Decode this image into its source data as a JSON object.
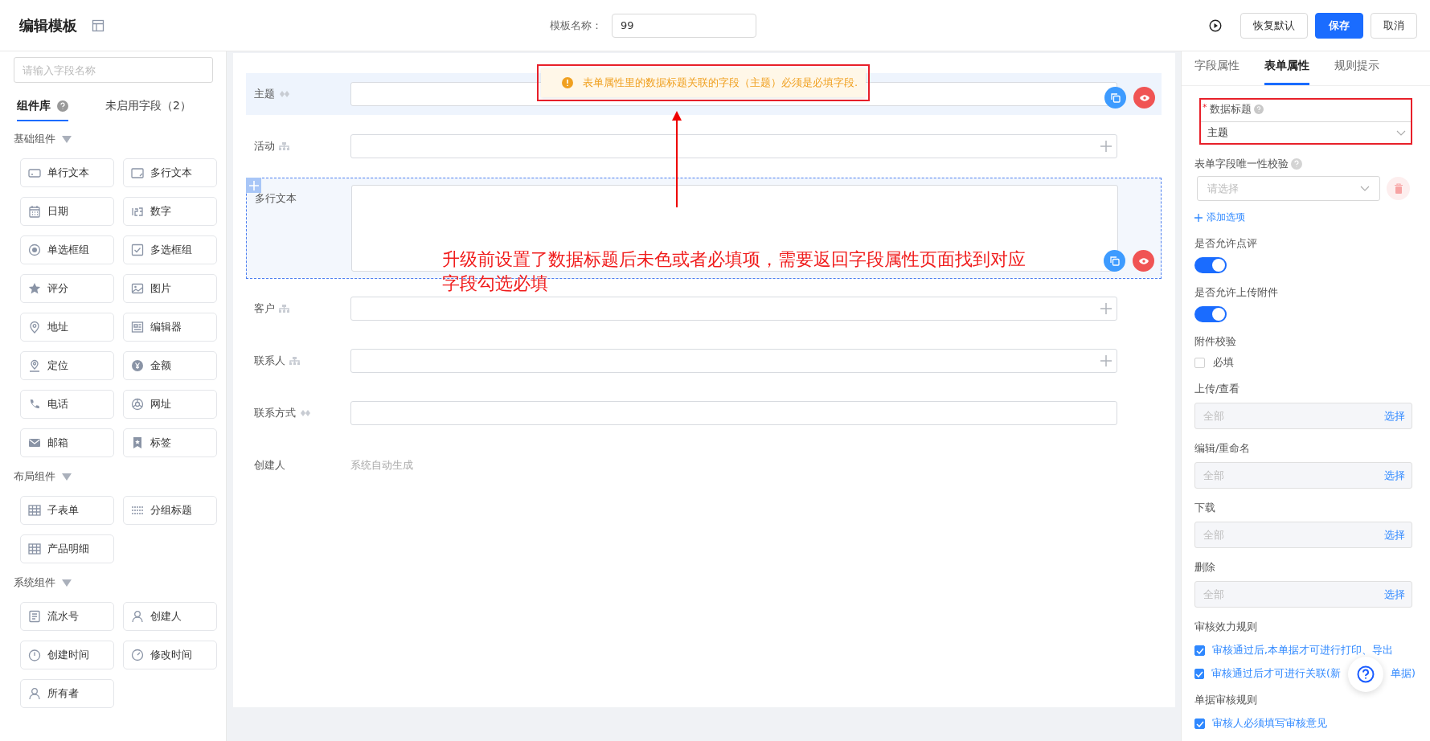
{
  "header": {
    "title": "编辑模板",
    "name_label": "模板名称：",
    "name_value": "99",
    "buttons": [
      {
        "label": "恢复默认",
        "kind": "default"
      },
      {
        "label": "保存",
        "kind": "primary"
      },
      {
        "label": "取消",
        "kind": "default"
      }
    ]
  },
  "sidebar": {
    "search_placeholder": "请输入字段名称",
    "tabs": [
      {
        "label": "组件库",
        "selected": true,
        "help": true
      },
      {
        "label": "未启用字段（2）",
        "selected": false,
        "help": false
      }
    ],
    "groups": [
      {
        "title": "基础组件",
        "items": [
          {
            "label": "单行文本"
          },
          {
            "label": "多行文本"
          },
          {
            "label": "日期"
          },
          {
            "label": "数字"
          },
          {
            "label": "单选框组"
          },
          {
            "label": "多选框组"
          },
          {
            "label": "评分"
          },
          {
            "label": "图片"
          },
          {
            "label": "地址"
          },
          {
            "label": "编辑器"
          },
          {
            "label": "定位"
          },
          {
            "label": "金额"
          },
          {
            "label": "电话"
          },
          {
            "label": "网址"
          },
          {
            "label": "邮箱"
          },
          {
            "label": "标签"
          }
        ]
      },
      {
        "title": "布局组件",
        "items": [
          {
            "label": "子表单"
          },
          {
            "label": "分组标题"
          },
          {
            "label": "产品明细"
          }
        ]
      },
      {
        "title": "系统组件",
        "items": [
          {
            "label": "流水号"
          },
          {
            "label": "创建人"
          },
          {
            "label": "创建时间"
          },
          {
            "label": "修改时间"
          },
          {
            "label": "所有者"
          }
        ]
      }
    ]
  },
  "form": {
    "toast": "表单属性里的数据标题关联的字段（主题）必须是必填字段.",
    "fields": [
      {
        "label": "主题",
        "kind": "text",
        "hovered": true,
        "selected": false
      },
      {
        "label": "活动",
        "kind": "relation",
        "hovered": false,
        "selected": false
      },
      {
        "label": "多行文本",
        "kind": "multiline",
        "hovered": false,
        "selected": true
      },
      {
        "label": "客户",
        "kind": "relation",
        "hovered": false,
        "selected": false
      },
      {
        "label": "联系人",
        "kind": "relation",
        "hovered": false,
        "selected": false
      },
      {
        "label": "联系方式",
        "kind": "text",
        "hovered": false,
        "selected": false
      },
      {
        "label": "创建人",
        "kind": "auto",
        "value": "系统自动生成",
        "hovered": false,
        "selected": false
      }
    ]
  },
  "annotation": {
    "text": "升级前设置了数据标题后未色或者必填项，需要返回字段属性页面找到对应字段勾选必填"
  },
  "properties": {
    "tabs": [
      {
        "label": "字段属性",
        "selected": false
      },
      {
        "label": "表单属性",
        "selected": true
      },
      {
        "label": "规则提示",
        "selected": false
      }
    ],
    "data_title": {
      "required_mark": "*",
      "label": "数据标题",
      "value": "主题"
    },
    "unique": {
      "label": "表单字段唯一性校验",
      "placeholder": "请选择",
      "add_label": "添加选项"
    },
    "toggles": [
      {
        "label": "是否允许点评",
        "on": true
      },
      {
        "label": "是否允许上传附件",
        "on": true
      }
    ],
    "attachment": {
      "label": "附件校验",
      "option": "必填",
      "checked": false
    },
    "permissions": [
      {
        "label": "上传/查看",
        "placeholder": "全部",
        "action": "选择"
      },
      {
        "label": "编辑/重命名",
        "placeholder": "全部",
        "action": "选择"
      },
      {
        "label": "下载",
        "placeholder": "全部",
        "action": "选择"
      },
      {
        "label": "删除",
        "placeholder": "全部",
        "action": "选择"
      }
    ],
    "rules": [
      {
        "title": "审核效力规则",
        "items": [
          {
            "parts": [
              "审核通过后,本单据才可进行打印、导出"
            ],
            "checked": true
          },
          {
            "parts": [
              "审核通过后才可进行关联(新",
              "单据)"
            ],
            "checked": true
          }
        ]
      },
      {
        "title": "单据审核规则",
        "items": [
          {
            "parts": [
              "审核人必须填写审核意见"
            ],
            "checked": true
          }
        ]
      }
    ]
  }
}
